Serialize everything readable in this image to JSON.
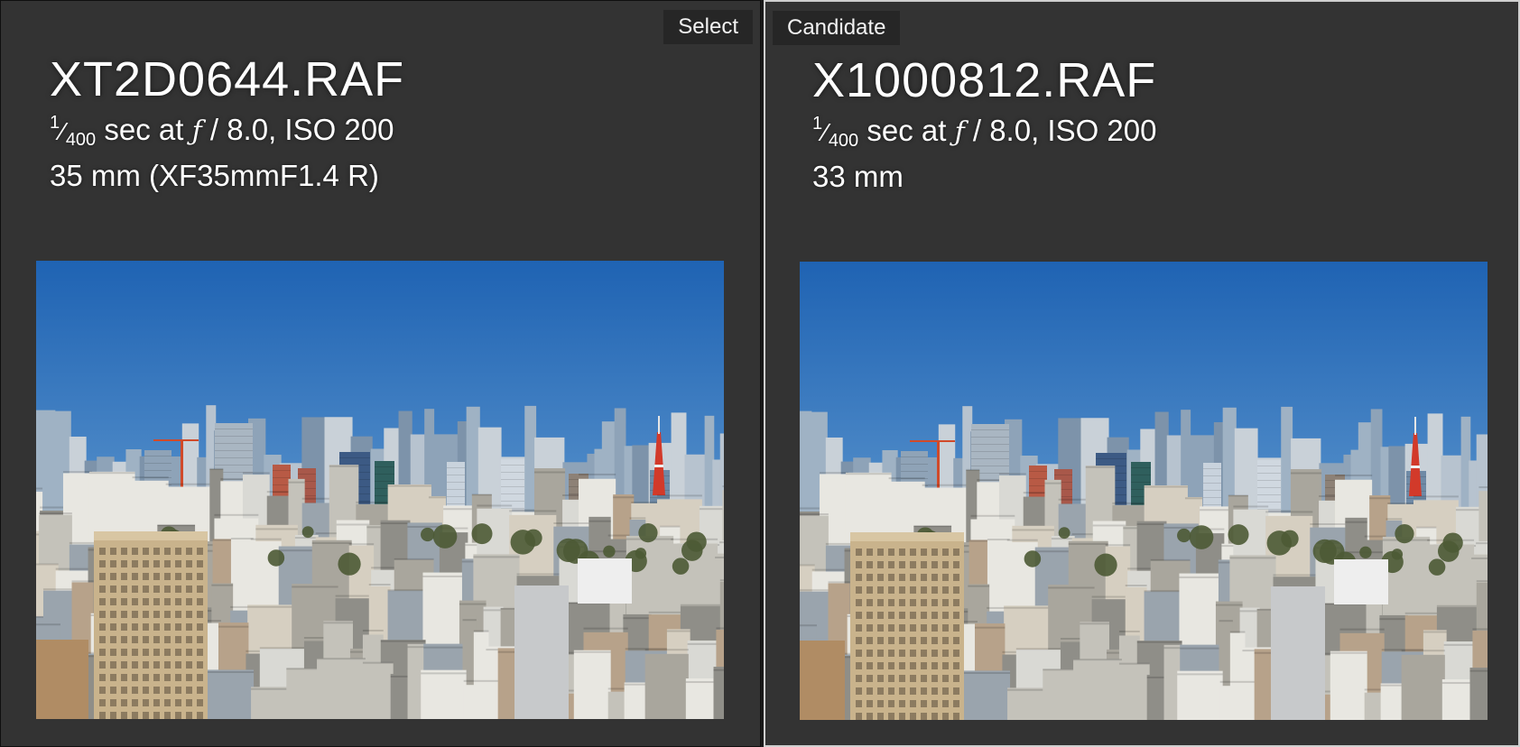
{
  "left": {
    "tag": "Select",
    "filename": "XT2D0644.RAF",
    "shutter_num": "1",
    "shutter_den": "400",
    "exposure_text": " sec at ",
    "aperture_symbol": "ƒ",
    "aperture_text": " / 8.0, ISO 200",
    "lens": "35 mm (XF35mmF1.4 R)"
  },
  "right": {
    "tag": "Candidate",
    "filename": "X1000812.RAF",
    "shutter_num": "1",
    "shutter_den": "400",
    "exposure_text": " sec at ",
    "aperture_symbol": "ƒ",
    "aperture_text": " / 8.0, ISO 200",
    "lens": "33 mm"
  },
  "colors": {
    "pane_bg": "#333333",
    "tag_bg": "#262626",
    "candidate_border": "#cfcfcf",
    "sky_top": "#1f63b3",
    "sky_bottom": "#7fb3dd"
  }
}
